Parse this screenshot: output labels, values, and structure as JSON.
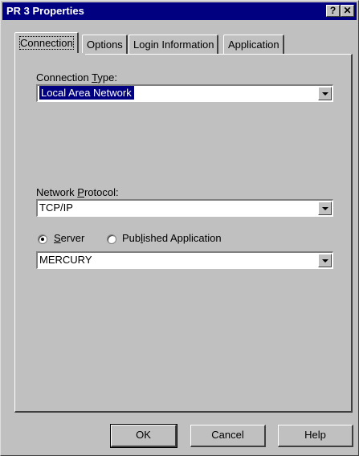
{
  "window": {
    "title": "PR 3 Properties",
    "help_button": "?",
    "close_button": "✕"
  },
  "tabs": [
    {
      "label": "Connection",
      "active": true
    },
    {
      "label": "Options",
      "active": false
    },
    {
      "label": "Login Information",
      "active": false
    },
    {
      "label": "Application",
      "active": false
    }
  ],
  "connection_type": {
    "label_pre": "Connection ",
    "label_key": "T",
    "label_post": "ype:",
    "value": "Local Area Network"
  },
  "network_protocol": {
    "label_pre": "Network ",
    "label_key": "P",
    "label_post": "rotocol:",
    "value": "TCP/IP"
  },
  "browse_type": {
    "server": {
      "label_key": "S",
      "label_post": "erver",
      "checked": true
    },
    "published": {
      "label_pre": "Pub",
      "label_key": "l",
      "label_post": "ished Application",
      "checked": false
    }
  },
  "server_value": "MERCURY",
  "buttons": {
    "ok": "OK",
    "cancel": "Cancel",
    "help": "Help"
  }
}
